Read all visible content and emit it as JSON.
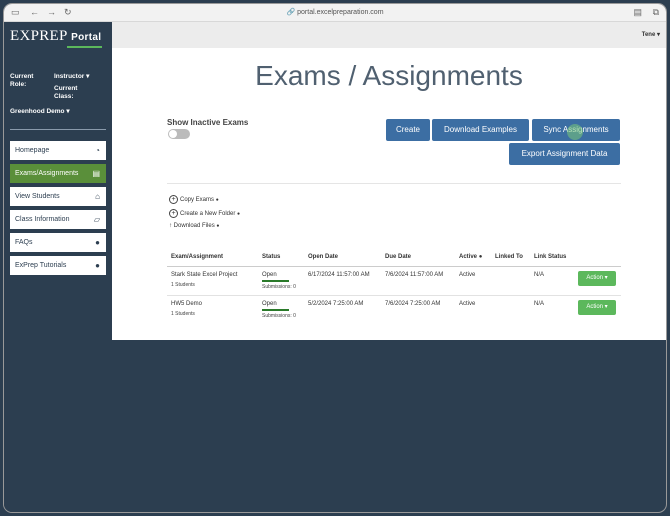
{
  "browser": {
    "url": "portal.excelpreparation.com"
  },
  "sidebar": {
    "logo": "EXPREP",
    "logo_sub": "Portal",
    "role_label": "Current Role:",
    "role_value": "Instructor",
    "class_label": "Current Class:",
    "class_value": "Greenhood Demo",
    "items": [
      {
        "label": "Homepage",
        "icon": "dashboard-icon"
      },
      {
        "label": "Exams/Assignments",
        "icon": "file-icon"
      },
      {
        "label": "View Students",
        "icon": "institution-icon"
      },
      {
        "label": "Class Information",
        "icon": "folder-open-icon"
      },
      {
        "label": "FAQs",
        "icon": "question-circle-icon"
      },
      {
        "label": "ExPrep Tutorials",
        "icon": "question-circle-icon"
      }
    ]
  },
  "topbar": {
    "user": "Tene"
  },
  "main": {
    "title": "Exams / Assignments",
    "show_inactive": "Show Inactive Exams",
    "buttons": {
      "create": "Create",
      "download_examples": "Download Examples",
      "sync": "Sync Assignments",
      "export": "Export Assignment Data"
    },
    "links": {
      "copy": "Copy Exams",
      "new_folder": "Create a New Folder",
      "download_files": "Download Files"
    },
    "table": {
      "headers": [
        "Exam/Assignment",
        "Status",
        "Open Date",
        "Due Date",
        "Active",
        "Linked To",
        "Link Status"
      ],
      "rows": [
        {
          "name": "Stark State Excel Project",
          "students": "1 Students",
          "status": "Open",
          "submissions": "Submissions: 0",
          "open": "6/17/2024 11:57:00 AM",
          "due": "7/6/2024 11:57:00 AM",
          "active": "Active",
          "linked": "",
          "link_status": "N/A",
          "action": "Action"
        },
        {
          "name": "HW5 Demo",
          "students": "1 Students",
          "status": "Open",
          "submissions": "Submissions: 0",
          "open": "5/2/2024 7:25:00 AM",
          "due": "7/6/2024 7:25:00 AM",
          "active": "Active",
          "linked": "",
          "link_status": "N/A",
          "action": "Action"
        }
      ]
    }
  },
  "colors": {
    "navy": "#2c3e50",
    "primary": "#3c6ea3",
    "success": "#5cb85c",
    "active_nav": "#5a8f3a"
  }
}
